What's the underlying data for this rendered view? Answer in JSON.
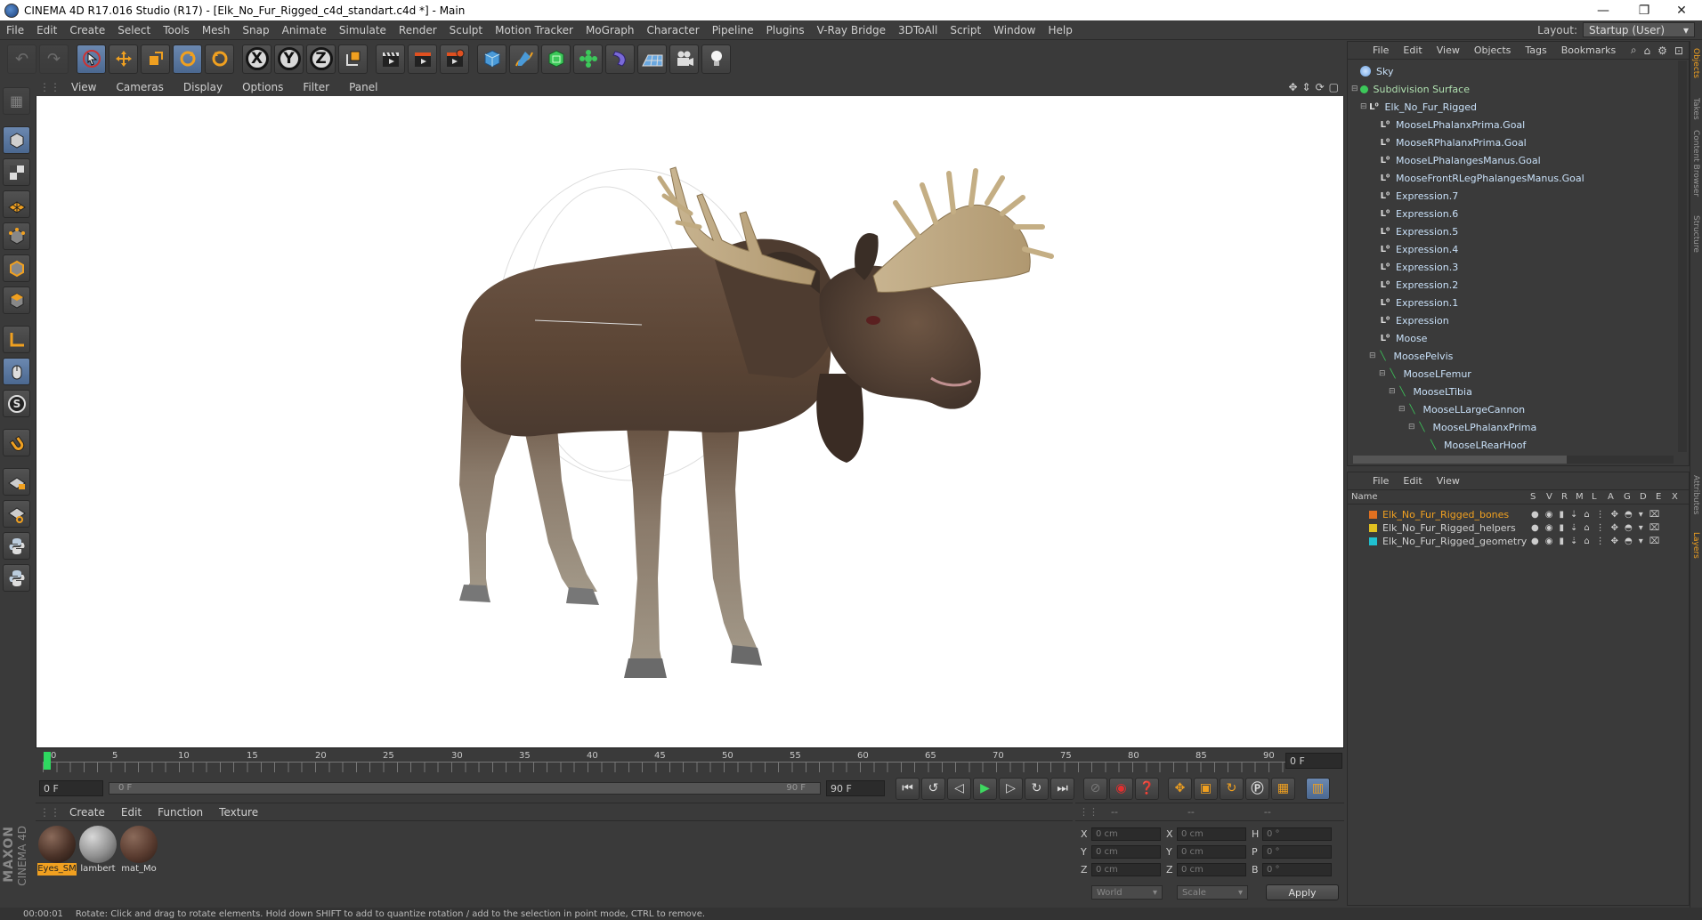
{
  "window": {
    "title": "CINEMA 4D R17.016 Studio (R17) - [Elk_No_Fur_Rigged_c4d_standart.c4d *] - Main",
    "controls": [
      "—",
      "❐",
      "✕"
    ]
  },
  "menu": [
    "File",
    "Edit",
    "Create",
    "Select",
    "Tools",
    "Mesh",
    "Snap",
    "Animate",
    "Simulate",
    "Render",
    "Sculpt",
    "Motion Tracker",
    "MoGraph",
    "Character",
    "Pipeline",
    "Plugins",
    "V-Ray Bridge",
    "3DToAll",
    "Script",
    "Window",
    "Help"
  ],
  "layout": {
    "label": "Layout:",
    "value": "Startup (User)"
  },
  "toolbar": {
    "axis_x": "X",
    "axis_y": "Y",
    "axis_z": "Z"
  },
  "viewport": {
    "menu": [
      "View",
      "Cameras",
      "Display",
      "Options",
      "Filter",
      "Panel"
    ]
  },
  "timeline": {
    "ticks": [
      "0",
      "5",
      "10",
      "15",
      "20",
      "25",
      "30",
      "35",
      "40",
      "45",
      "50",
      "55",
      "60",
      "65",
      "70",
      "75",
      "80",
      "85",
      "90"
    ],
    "current_frame": "0 F",
    "start_field": "0 F",
    "range_start": "0 F",
    "range_end": "90 F",
    "end_field": "90 F"
  },
  "materials": {
    "menu": [
      "Create",
      "Edit",
      "Function",
      "Texture"
    ],
    "items": [
      {
        "name": "Eyes_SM",
        "selected": true
      },
      {
        "name": "lambert",
        "selected": false
      },
      {
        "name": "mat_Mo",
        "selected": false
      }
    ]
  },
  "coords": {
    "header": [
      "--",
      "--",
      "--"
    ],
    "rows": [
      {
        "a": "X",
        "v1": "0 cm",
        "b": "X",
        "v2": "0 cm",
        "c": "H",
        "v3": "0 °"
      },
      {
        "a": "Y",
        "v1": "0 cm",
        "b": "Y",
        "v2": "0 cm",
        "c": "P",
        "v3": "0 °"
      },
      {
        "a": "Z",
        "v1": "0 cm",
        "b": "Z",
        "v2": "0 cm",
        "c": "B",
        "v3": "0 °"
      }
    ],
    "mode": "World",
    "transform": "Scale",
    "apply": "Apply"
  },
  "objects": {
    "menu": [
      "File",
      "Edit",
      "View",
      "Objects",
      "Tags",
      "Bookmarks"
    ],
    "items": [
      {
        "name": "Sky",
        "depth": 0,
        "icon": "sky"
      },
      {
        "name": "Subdivision Surface",
        "depth": 0,
        "icon": "subdiv"
      },
      {
        "name": "Elk_No_Fur_Rigged",
        "depth": 1,
        "icon": "null"
      },
      {
        "name": "MooseLPhalanxPrima.Goal",
        "depth": 2,
        "icon": "null"
      },
      {
        "name": "MooseRPhalanxPrima.Goal",
        "depth": 2,
        "icon": "null"
      },
      {
        "name": "MooseLPhalangesManus.Goal",
        "depth": 2,
        "icon": "null"
      },
      {
        "name": "MooseFrontRLegPhalangesManus.Goal",
        "depth": 2,
        "icon": "null"
      },
      {
        "name": "Expression.7",
        "depth": 2,
        "icon": "null"
      },
      {
        "name": "Expression.6",
        "depth": 2,
        "icon": "null"
      },
      {
        "name": "Expression.5",
        "depth": 2,
        "icon": "null"
      },
      {
        "name": "Expression.4",
        "depth": 2,
        "icon": "null"
      },
      {
        "name": "Expression.3",
        "depth": 2,
        "icon": "null"
      },
      {
        "name": "Expression.2",
        "depth": 2,
        "icon": "null"
      },
      {
        "name": "Expression.1",
        "depth": 2,
        "icon": "null"
      },
      {
        "name": "Expression",
        "depth": 2,
        "icon": "null"
      },
      {
        "name": "Moose",
        "depth": 2,
        "icon": "null"
      },
      {
        "name": "MoosePelvis",
        "depth": 2,
        "icon": "bone"
      },
      {
        "name": "MooseLFemur",
        "depth": 3,
        "icon": "bone"
      },
      {
        "name": "MooseLTibia",
        "depth": 4,
        "icon": "bone"
      },
      {
        "name": "MooseLLargeCannon",
        "depth": 5,
        "icon": "bone"
      },
      {
        "name": "MooseLPhalanxPrima",
        "depth": 6,
        "icon": "bone"
      },
      {
        "name": "MooseLRearHoof",
        "depth": 7,
        "icon": "bone"
      }
    ]
  },
  "layers": {
    "menu": [
      "File",
      "Edit",
      "View"
    ],
    "header": {
      "name": "Name",
      "cols": [
        "S",
        "V",
        "R",
        "M",
        "L",
        "A",
        "G",
        "D",
        "E",
        "X"
      ]
    },
    "items": [
      {
        "name": "Elk_No_Fur_Rigged_bones",
        "color": "#e07020",
        "text_color": "#f0a020"
      },
      {
        "name": "Elk_No_Fur_Rigged_helpers",
        "color": "#e0c020",
        "text_color": "#d0d0d0"
      },
      {
        "name": "Elk_No_Fur_Rigged_geometry",
        "color": "#20c0d0",
        "text_color": "#d0d0d0"
      }
    ]
  },
  "status": {
    "time": "00:00:01",
    "message": "Rotate: Click and drag to rotate elements. Hold down SHIFT to add to quantize rotation / add to the selection in point mode, CTRL to remove."
  },
  "side_tabs": [
    "Objects",
    "Takes",
    "Content Browser",
    "Structure",
    "Attributes",
    "Layers"
  ],
  "brand": {
    "line1": "MAXON",
    "line2": "CINEMA 4D"
  }
}
